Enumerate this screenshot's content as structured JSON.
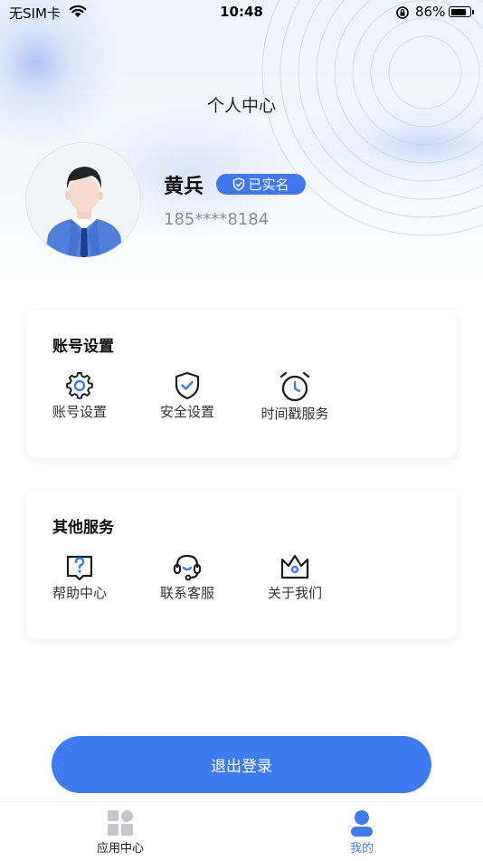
{
  "status_bar": {
    "carrier": "无SIM卡",
    "time": "10:48",
    "battery": "86%",
    "battery_level": 0.86
  },
  "header": {
    "title": "个人中心"
  },
  "profile": {
    "name": "黄兵",
    "badge": "已实名",
    "phone": "185****8184"
  },
  "account_section": {
    "title": "账号设置",
    "items": [
      {
        "label": "账号设置",
        "icon": "gear-icon"
      },
      {
        "label": "安全设置",
        "icon": "shield-check-icon"
      },
      {
        "label": "时间戳服务",
        "icon": "alarm-clock-icon"
      }
    ]
  },
  "other_section": {
    "title": "其他服务",
    "items": [
      {
        "label": "帮助中心",
        "icon": "help-question-icon"
      },
      {
        "label": "联系客服",
        "icon": "headset-icon"
      },
      {
        "label": "关于我们",
        "icon": "crown-icon"
      }
    ]
  },
  "logout": {
    "label": "退出登录"
  },
  "tab_bar": {
    "tabs": [
      {
        "label": "应用中心",
        "icon": "apps-grid-icon",
        "active": false
      },
      {
        "label": "我的",
        "icon": "user-icon",
        "active": true
      }
    ]
  },
  "colors": {
    "accent": "#3f7bf0",
    "text": "#1a1a1a",
    "muted": "#8a8d93"
  }
}
